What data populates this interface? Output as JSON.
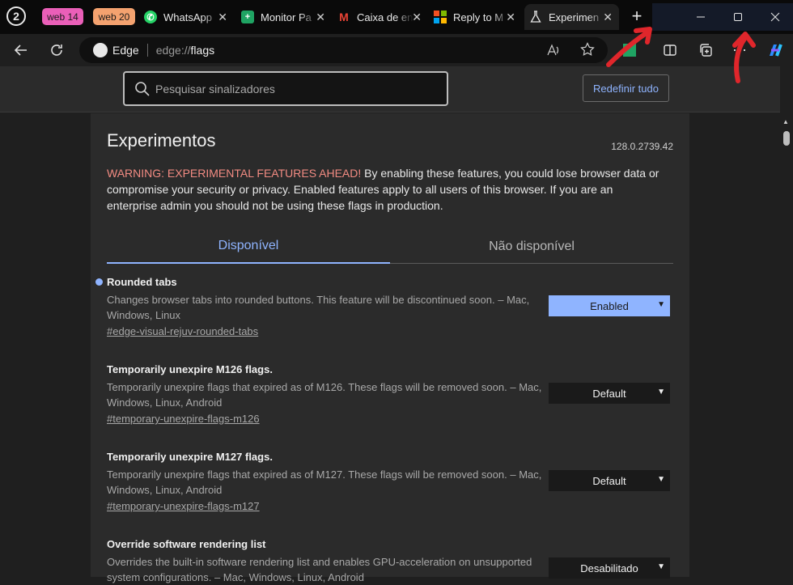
{
  "tabstrip": {
    "groups": [
      {
        "label": "web 14",
        "color": "#ea5fb8"
      },
      {
        "label": "web 20",
        "color": "#f4a26f"
      }
    ],
    "tabs": [
      {
        "title": "WhatsApp",
        "icon": "whatsapp-icon"
      },
      {
        "title": "Monitor Pa",
        "icon": "sheets-icon"
      },
      {
        "title": "Caixa de en",
        "icon": "gmail-icon"
      },
      {
        "title": "Reply to M",
        "icon": "microsoft-icon"
      },
      {
        "title": "Experimen",
        "icon": "flask-icon",
        "active": true
      }
    ],
    "new_tab": "+"
  },
  "toolbar": {
    "site_label": "Edge",
    "url_prefix": "edge://",
    "url_path": "flags"
  },
  "search": {
    "placeholder": "Pesquisar sinalizadores"
  },
  "reset_label": "Redefinir tudo",
  "page": {
    "title": "Experimentos",
    "version": "128.0.2739.42",
    "warning_prefix": "WARNING: EXPERIMENTAL FEATURES AHEAD!",
    "warning_text": " By enabling these features, you could lose browser data or compromise your security or privacy. Enabled features apply to all users of this browser. If you are an enterprise admin you should not be using these flags in production.",
    "tabs": {
      "available": "Disponível",
      "unavailable": "Não disponível"
    }
  },
  "flags": [
    {
      "name": "Rounded tabs",
      "description": "Changes browser tabs into rounded buttons. This feature will be discontinued soon. – Mac, Windows, Linux",
      "link": "#edge-visual-rejuv-rounded-tabs",
      "value": "Enabled",
      "modified": true
    },
    {
      "name": "Temporarily unexpire M126 flags.",
      "description": "Temporarily unexpire flags that expired as of M126. These flags will be removed soon. – Mac, Windows, Linux, Android",
      "link": "#temporary-unexpire-flags-m126",
      "value": "Default"
    },
    {
      "name": "Temporarily unexpire M127 flags.",
      "description": "Temporarily unexpire flags that expired as of M127. These flags will be removed soon. – Mac, Windows, Linux, Android",
      "link": "#temporary-unexpire-flags-m127",
      "value": "Default"
    },
    {
      "name": "Override software rendering list",
      "description": "Overrides the built-in software rendering list and enables GPU-acceleration on unsupported system configurations. – Mac, Windows, Linux, Android",
      "link": "",
      "value": "Desabilitado"
    }
  ],
  "colors": {
    "accent": "#8fb4ff",
    "warning": "#f28b82",
    "annotation": "#e0262b"
  }
}
